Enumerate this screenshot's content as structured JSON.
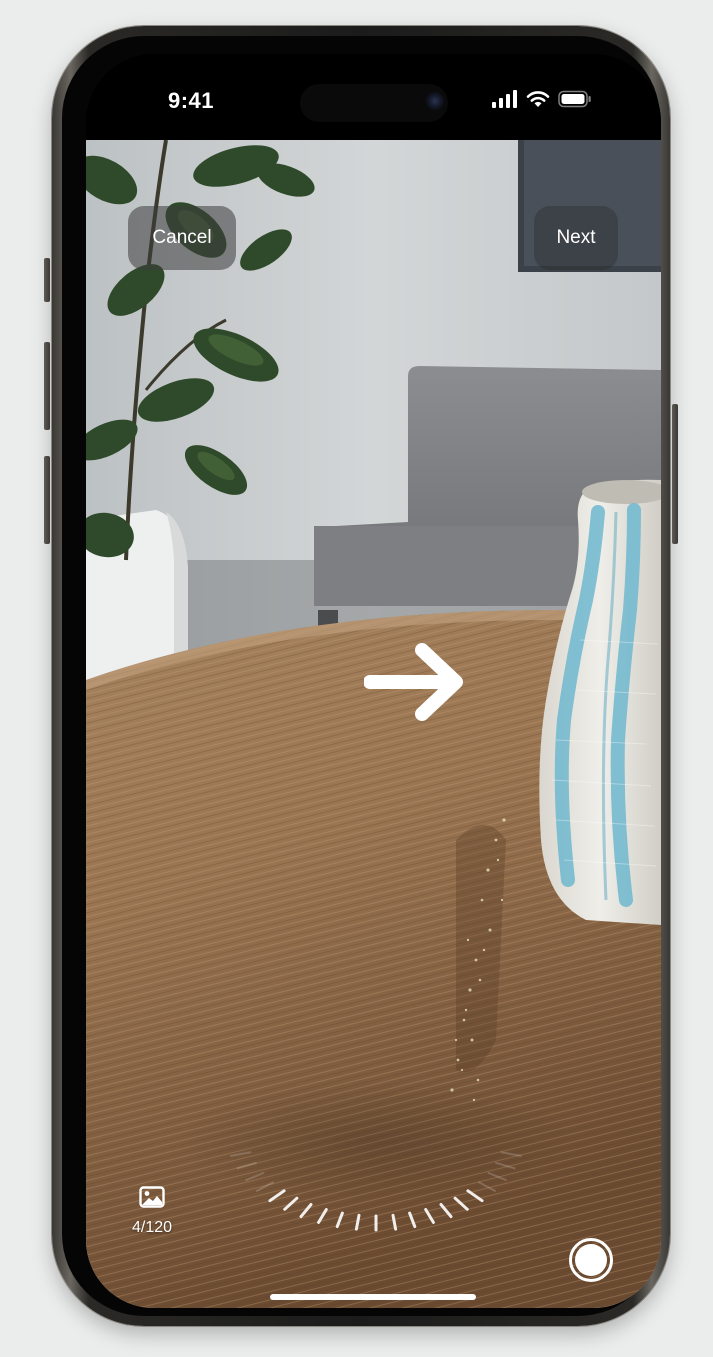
{
  "status_bar": {
    "time": "9:41",
    "icons": [
      "cellular-signal-icon",
      "wifi-icon",
      "battery-icon"
    ]
  },
  "toolbar": {
    "cancel_label": "Cancel",
    "next_label": "Next"
  },
  "guidance": {
    "icon": "arrow-right-icon",
    "direction": "right"
  },
  "photo_counter": {
    "icon": "photo-icon",
    "count_text": "4/120"
  },
  "capture": {
    "icon": "shutter-icon"
  },
  "capture_dial": {
    "segments_captured": 12
  },
  "colors": {
    "ui_text": "#ffffff",
    "button_bg": "#3c3c3c"
  }
}
